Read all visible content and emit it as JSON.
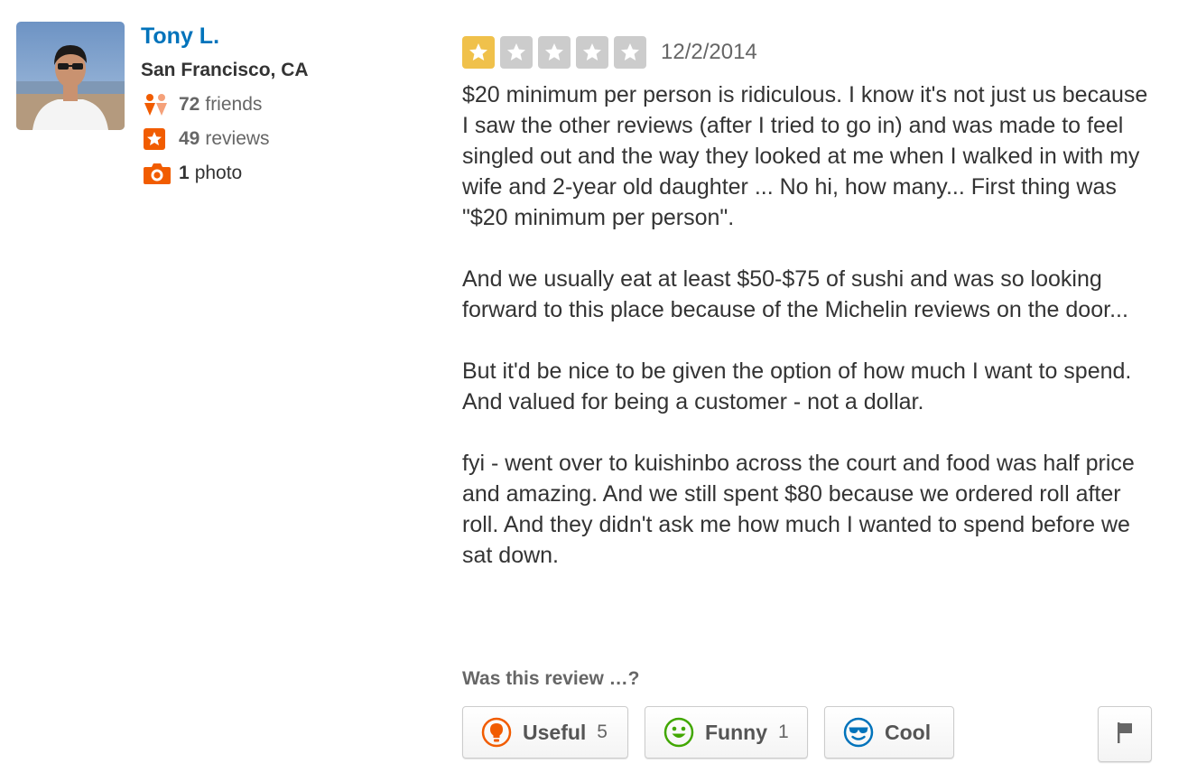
{
  "user": {
    "name": "Tony L.",
    "location": "San Francisco, CA",
    "friends_count": "72",
    "friends_label": "friends",
    "reviews_count": "49",
    "reviews_label": "reviews",
    "photos_count": "1",
    "photos_label": "photo"
  },
  "review": {
    "rating": 1,
    "rating_max": 5,
    "date": "12/2/2014",
    "paragraphs": [
      "$20 minimum per person is ridiculous. I know it's not just us because I saw the other reviews (after I tried to go in) and was made to feel singled out and the way they looked at me when I walked in with my wife and 2-year old daughter ... No hi, how many... First thing was \"$20 minimum per person\".",
      "And we usually eat at least $50-$75 of sushi and was so looking forward to this place because of the Michelin reviews on the door...",
      "But it'd be nice to be given the option of how much I want to spend. And valued for being a customer - not a dollar.",
      "fyi - went over to kuishinbo across the court and food was half price and amazing. And we still spent $80 because we ordered roll after roll. And they didn't ask me how much I wanted to spend before we sat down."
    ]
  },
  "votes": {
    "prompt": "Was this review …?",
    "useful_label": "Useful",
    "useful_count": "5",
    "funny_label": "Funny",
    "funny_count": "1",
    "cool_label": "Cool",
    "cool_count": ""
  },
  "colors": {
    "link": "#0073bb",
    "star_filled": "#f0c14b",
    "star_empty": "#cccccc",
    "stat_icon": "#f15c00",
    "useful_icon": "#f15c00",
    "funny_icon": "#41a700",
    "cool_icon": "#0073bb"
  },
  "icons": {
    "friends": "friends-icon",
    "reviews": "star-badge-icon",
    "photos": "camera-icon",
    "useful": "lightbulb-icon",
    "funny": "smiley-icon",
    "cool": "sunglasses-smiley-icon",
    "flag": "flag-icon"
  }
}
